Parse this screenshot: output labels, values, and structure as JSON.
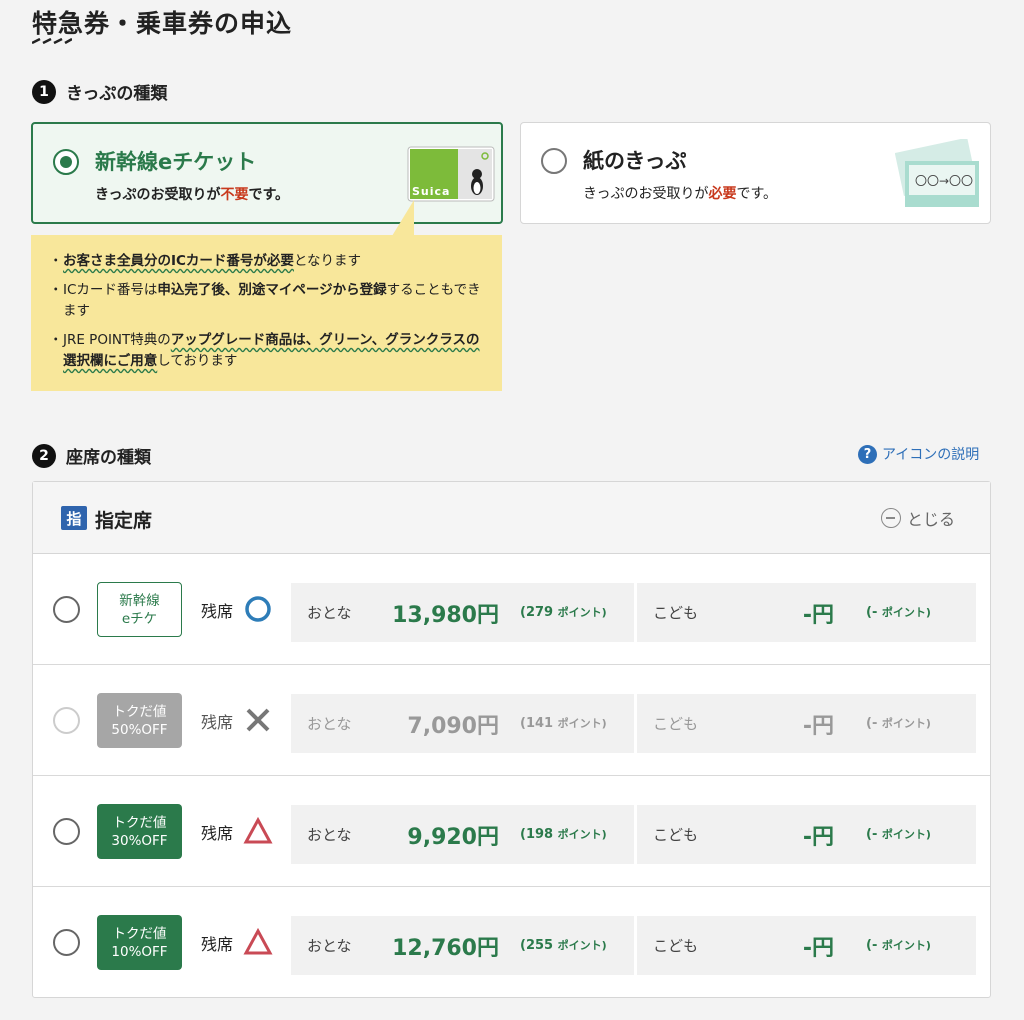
{
  "page_title": "特急券・乗車券の申込",
  "step1": {
    "num": "1",
    "heading": "きっぷの種類"
  },
  "ticket_options": [
    {
      "title": "新幹線eチケット",
      "sub_prefix": "きっぷのお受取りが",
      "sub_emph": "不要",
      "sub_suffix": "です。",
      "selected": true
    },
    {
      "title": "紙のきっぷ",
      "sub_prefix": "きっぷのお受取りが",
      "sub_emph": "必要",
      "sub_suffix": "です。",
      "selected": false
    }
  ],
  "suica_card_text": "Suica",
  "paper_ticket_text": "〇〇→〇〇",
  "info_lines": [
    {
      "bold": "お客さま全員分のICカード番号が必要",
      "rest": "となります"
    },
    {
      "lead": "ICカード番号は",
      "bold": "申込完了後、別途マイページから登録",
      "rest": "することもできます"
    },
    {
      "lead": "JRE POINT特典の",
      "bold": "アップグレード商品は、グリーン、グランクラスの選択欄にご用意",
      "rest": "しております"
    }
  ],
  "step2": {
    "num": "2",
    "heading": "座席の種類"
  },
  "icon_help_label": "アイコンの説明",
  "seat_section": {
    "badge": "指",
    "label": "指定席",
    "close_label": "とじる"
  },
  "seat_rows": [
    {
      "plan_line1": "新幹線",
      "plan_line2": "eチケ",
      "style": "outline",
      "avail_label": "残席",
      "avail": "circle",
      "adult_label": "おとな",
      "adult_price": "13,980円",
      "adult_points": "(279",
      "child_label": "こども",
      "child_price": "-円",
      "child_points": "(-",
      "points_unit": "ポイント)",
      "disabled": false
    },
    {
      "plan_line1": "トクだ値",
      "plan_line2": "50%OFF",
      "style": "gray",
      "avail_label": "残席",
      "avail": "cross",
      "adult_label": "おとな",
      "adult_price": "7,090円",
      "adult_points": "(141",
      "child_label": "こども",
      "child_price": "-円",
      "child_points": "(-",
      "points_unit": "ポイント)",
      "disabled": true
    },
    {
      "plan_line1": "トクだ値",
      "plan_line2": "30%OFF",
      "style": "green",
      "avail_label": "残席",
      "avail": "triangle",
      "adult_label": "おとな",
      "adult_price": "9,920円",
      "adult_points": "(198",
      "child_label": "こども",
      "child_price": "-円",
      "child_points": "(-",
      "points_unit": "ポイント)",
      "disabled": false
    },
    {
      "plan_line1": "トクだ値",
      "plan_line2": "10%OFF",
      "style": "green",
      "avail_label": "残席",
      "avail": "triangle",
      "adult_label": "おとな",
      "adult_price": "12,760円",
      "adult_points": "(255",
      "child_label": "こども",
      "child_price": "-円",
      "child_points": "(-",
      "points_unit": "ポイント)",
      "disabled": false
    }
  ],
  "colors": {
    "accent_green": "#2b7a4b",
    "emphasis_red": "#c8391d",
    "info_yellow": "#f8e79b",
    "help_blue": "#2e6fb8"
  }
}
